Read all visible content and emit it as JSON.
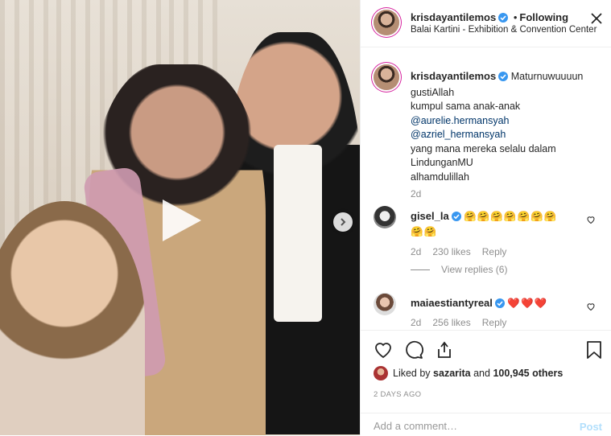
{
  "header": {
    "username": "krisdayantilemos",
    "separator": "•",
    "follow_state": "Following",
    "location": "Balai Kartini - Exhibition & Convention Center"
  },
  "caption": {
    "username": "krisdayantilemos",
    "lines": [
      "Maturnuwuuuun",
      "gustiAllah",
      "kumpul sama anak-anak",
      "@aurelie.hermansyah",
      "@azriel_hermansyah",
      "yang mana mereka selalu dalam",
      "LindunganMU",
      "alhamdulillah"
    ],
    "time": "2d"
  },
  "comments": [
    {
      "username": "gisel_la",
      "text": "🤗🤗🤗🤗🤗🤗🤗",
      "text2": "🤗🤗",
      "time": "2d",
      "likes": "230 likes",
      "reply": "Reply",
      "view_replies": "View replies (6)"
    },
    {
      "username": "maiaestiantyreal",
      "text": "❤️❤️❤️",
      "time": "2d",
      "likes": "256 likes",
      "reply": "Reply"
    }
  ],
  "likes": {
    "prefix": "Liked by",
    "user": "sazarita",
    "and": "and",
    "count": "100,945 others"
  },
  "date": "2 DAYS AGO",
  "add_comment": {
    "placeholder": "Add a comment…",
    "post_label": "Post"
  },
  "colors": {
    "accent_link": "#003569",
    "verified_blue": "#3897f0",
    "post_disabled": "#b2dffc"
  }
}
